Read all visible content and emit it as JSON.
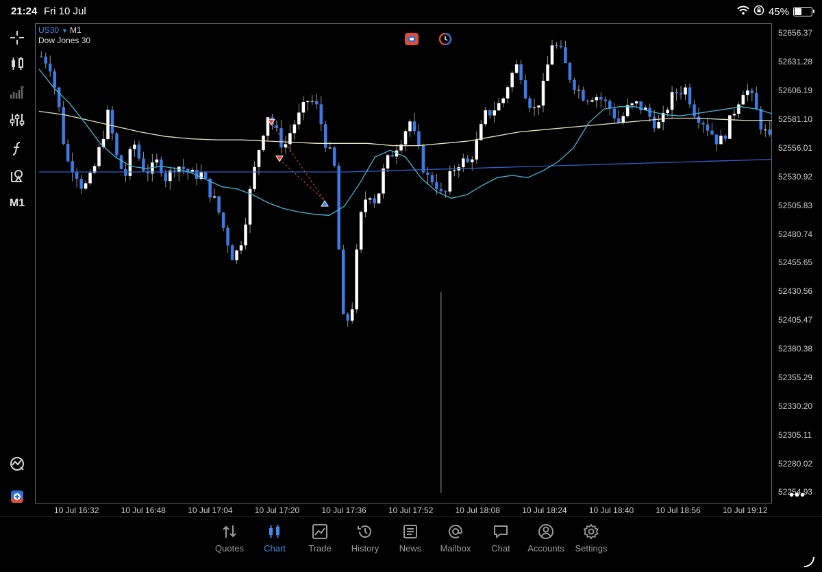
{
  "status": {
    "time": "21:24",
    "date": "Fri 10 Jul",
    "battery": "45%",
    "battery_level": 0.45
  },
  "chart_header": {
    "symbol": "US30",
    "timeframe": "M1",
    "description": "Dow Jones 30"
  },
  "left_tools": [
    "crosshair-icon",
    "candlestick-icon",
    "indicators-icon",
    "settings-sliders-icon",
    "function-icon",
    "objects-icon",
    "timeframe-label"
  ],
  "left_tools_timeframe": "M1",
  "colors": {
    "bull": "#ffffff",
    "bear": "#3c7be6",
    "ma_fast": "#3fb8d6",
    "ma_mid": "#e8e4c6",
    "ma_slow": "#2f5fcf",
    "accent": "#3c8ff0"
  },
  "chart_data": {
    "type": "candlestick",
    "symbol": "US30",
    "timeframe": "M1",
    "price_ticks": [
      "52656.37",
      "52631.28",
      "52606.19",
      "52581.10",
      "52556.01",
      "52530.92",
      "52505.83",
      "52480.74",
      "52455.65",
      "52430.56",
      "52405.47",
      "52380.38",
      "52355.29",
      "52330.20",
      "52305.11",
      "52280.02",
      "52254.93"
    ],
    "time_ticks": [
      "10 Jul 16:32",
      "10 Jul 16:48",
      "10 Jul 17:04",
      "10 Jul 17:20",
      "10 Jul 17:36",
      "10 Jul 17:52",
      "10 Jul 18:08",
      "10 Jul 18:24",
      "10 Jul 18:40",
      "10 Jul 18:56",
      "10 Jul 19:12"
    ],
    "ylim": [
      52245,
      52665
    ],
    "close_path": [
      52636,
      52630,
      52596,
      52545,
      52538,
      52520,
      52530,
      52556,
      52586,
      52548,
      52530,
      52562,
      52540,
      52535,
      52545,
      52528,
      52542,
      52538,
      52532,
      52534,
      52520,
      52505,
      52480,
      52458,
      52478,
      52520,
      52556,
      52586,
      52570,
      52556,
      52575,
      52586,
      52600,
      52590,
      52560,
      52540,
      52405,
      52407,
      52490,
      52520,
      52508,
      52540,
      52553,
      52565,
      52580,
      52555,
      52530,
      52528,
      52510,
      52535,
      52545,
      52542,
      52560,
      52584,
      52590,
      52596,
      52618,
      52630,
      52600,
      52588,
      52610,
      52648,
      52640,
      52620,
      52608,
      52600,
      52603,
      52598,
      52590,
      52578,
      52590,
      52594,
      52590,
      52580,
      52575,
      52597,
      52606,
      52608,
      52588,
      52580,
      52570,
      52560,
      52574,
      52594,
      52610,
      52597,
      52575,
      52562
    ],
    "ma_fast": [
      52625,
      52608,
      52595,
      52578,
      52560,
      52548,
      52540,
      52538,
      52540,
      52538,
      52534,
      52528,
      52522,
      52520,
      52515,
      52508,
      52503,
      52500,
      52498,
      52497,
      52505,
      52525,
      52548,
      52554,
      52548,
      52530,
      52518,
      52512,
      52515,
      52523,
      52530,
      52532,
      52530,
      52536,
      52544,
      52556,
      52578,
      52590,
      52592,
      52592,
      52588,
      52585,
      52584,
      52586,
      52588,
      52590,
      52592,
      52590,
      52586
    ],
    "ma_mid": [
      52588,
      52585,
      52580,
      52575,
      52570,
      52566,
      52564,
      52563,
      52563,
      52562,
      52561,
      52560,
      52560,
      52560,
      52558,
      52558,
      52560,
      52562,
      52566,
      52570,
      52572,
      52574,
      52576,
      52578,
      52580,
      52582,
      52582,
      52581,
      52580,
      52580
    ],
    "ma_slow": [
      52535,
      52535,
      52535,
      52535,
      52535,
      52535,
      52535,
      52535,
      52535,
      52536,
      52537,
      52538,
      52539,
      52540,
      52541,
      52542,
      52543,
      52544,
      52545,
      52546
    ]
  },
  "axis_menu_glyph": "•••",
  "tabs": [
    {
      "label": "Quotes",
      "icon": "quotes-icon",
      "active": false
    },
    {
      "label": "Chart",
      "icon": "chart-icon",
      "active": true
    },
    {
      "label": "Trade",
      "icon": "trade-icon",
      "active": false
    },
    {
      "label": "History",
      "icon": "history-icon",
      "active": false
    },
    {
      "label": "News",
      "icon": "news-icon",
      "active": false
    },
    {
      "label": "Mailbox",
      "icon": "mailbox-icon",
      "active": false
    },
    {
      "label": "Chat",
      "icon": "chat-icon",
      "active": false
    },
    {
      "label": "Accounts",
      "icon": "accounts-icon",
      "active": false
    },
    {
      "label": "Settings",
      "icon": "settings-icon",
      "active": false
    }
  ]
}
